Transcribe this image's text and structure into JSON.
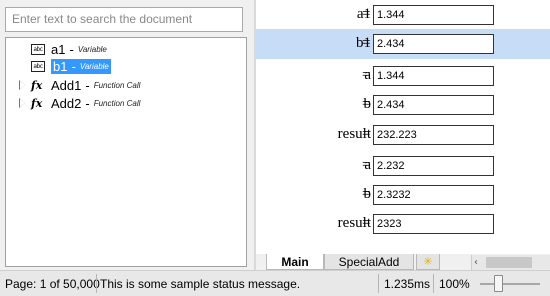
{
  "search": {
    "placeholder": "Enter text to search the document"
  },
  "tree": {
    "items": [
      {
        "name": "a1",
        "separator": "-",
        "kind": "Variable",
        "icon": "variable-abc-icon"
      },
      {
        "name": "b1",
        "separator": "-",
        "kind": "Variable",
        "icon": "variable-abc-icon",
        "selected": true
      },
      {
        "name": "Add1",
        "separator": "-",
        "kind": "Function Call",
        "icon": "function-fx-icon"
      },
      {
        "name": "Add2",
        "separator": "-",
        "kind": "Function Call",
        "icon": "function-fx-icon"
      }
    ]
  },
  "document": {
    "rows": [
      {
        "label": "a1",
        "equals": "=",
        "value": "1.344"
      },
      {
        "label": "b1",
        "equals": "=",
        "value": "2.434",
        "highlighted": true
      },
      {
        "label": "a",
        "equals": "=",
        "value": "1.344"
      },
      {
        "label": "b",
        "equals": "=",
        "value": "2.434"
      },
      {
        "label": "result",
        "equals": "=",
        "value": "232.223"
      },
      {
        "label": "a",
        "equals": "=",
        "value": "2.232"
      },
      {
        "label": "b",
        "equals": "=",
        "value": "2.3232"
      },
      {
        "label": "result",
        "equals": "=",
        "value": "2323"
      }
    ]
  },
  "tabs": [
    {
      "label": "Main",
      "active": true
    },
    {
      "label": "SpecialAdd",
      "active": false
    }
  ],
  "new_tab_icon": "new-tab-star-icon",
  "status": {
    "page": "Page: 1 of 50,000",
    "message": "This is some sample status message.",
    "timing": "1.235ms",
    "zoom": "100%"
  },
  "colors": {
    "selection": "#3399ff",
    "row_highlight": "#c7dcf7"
  }
}
